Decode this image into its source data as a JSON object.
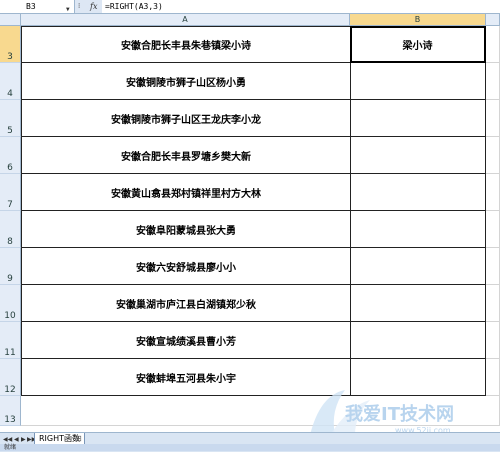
{
  "formula_bar": {
    "name_box": "B3",
    "fx_label": "fx",
    "formula": "=RIGHT(A3,3)"
  },
  "columns": {
    "A": "A",
    "B": "B"
  },
  "rows": [
    {
      "num": "3",
      "a": "安徽合肥长丰县朱巷镇梁小诗",
      "b": "梁小诗"
    },
    {
      "num": "4",
      "a": "安徽铜陵市狮子山区杨小勇",
      "b": ""
    },
    {
      "num": "5",
      "a": "安徽铜陵市狮子山区王龙庆李小龙",
      "b": ""
    },
    {
      "num": "6",
      "a": "安徽合肥长丰县罗塘乡樊大新",
      "b": ""
    },
    {
      "num": "7",
      "a": "安徽黄山翕县郑村镇祥里村方大林",
      "b": ""
    },
    {
      "num": "8",
      "a": "安徽阜阳蒙城县张大勇",
      "b": ""
    },
    {
      "num": "9",
      "a": "安徽六安舒城县廖小小",
      "b": ""
    },
    {
      "num": "10",
      "a": "安徽巢湖市庐江县白湖镇郑少秋",
      "b": ""
    },
    {
      "num": "11",
      "a": "安徽宣城绩溪县曹小芳",
      "b": ""
    },
    {
      "num": "12",
      "a": "安徽蚌埠五河县朱小宇",
      "b": ""
    },
    {
      "num": "13",
      "a": "",
      "b": ""
    }
  ],
  "sheet_tab": "RIGHT函数",
  "status_text": "就绪",
  "watermark": {
    "main": "我爱IT技术网",
    "sub": "www.52ij.com"
  },
  "colors": {
    "header_bg": "#e4ecf7",
    "active_header": "#f8d98f",
    "grid_line": "#222222"
  }
}
